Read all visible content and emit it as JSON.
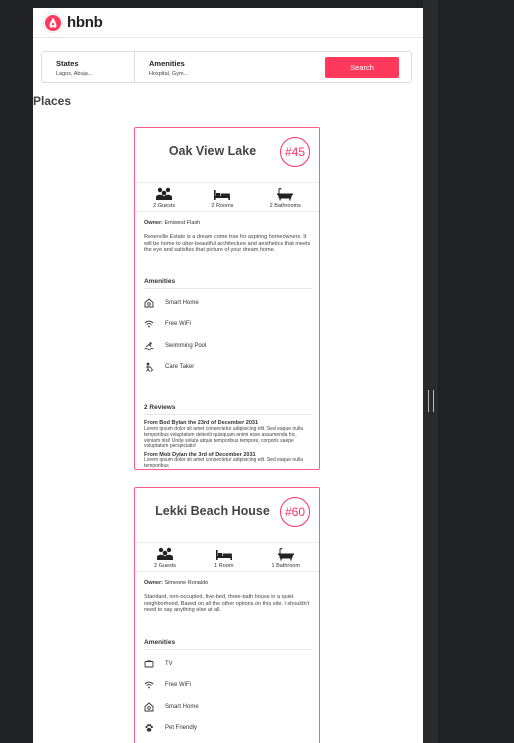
{
  "header": {
    "logo_text": "hbnb"
  },
  "filters": {
    "states": {
      "title": "States",
      "value": "Lagos, Abuja..."
    },
    "amenities": {
      "title": "Amenities",
      "value": "Hospital, Gym..."
    },
    "search_label": "Search"
  },
  "section_title": "Places",
  "places": [
    {
      "name": "Oak View Lake",
      "price": "#45",
      "guests": "2 Guests",
      "rooms": "2 Rooms",
      "bathrooms": "2 Bathrooms",
      "owner_label": "Owner:",
      "owner": "Emiwest Flash",
      "description": "Reserville Estate is a dream come true for aspiring homeowners. It will be home to uber-beautiful architecture and aesthetics that meets the eye and satisfies that picture of your dream home.",
      "amenities_title": "Amenities",
      "amenities": [
        {
          "label": "Smart Home",
          "icon": "smart-home-icon"
        },
        {
          "label": "Free WiFi",
          "icon": "wifi-icon"
        },
        {
          "label": "Swimming Pool",
          "icon": "pool-icon"
        },
        {
          "label": "Care Taker",
          "icon": "caretaker-icon"
        }
      ],
      "reviews_title": "2 Reviews",
      "reviews": [
        {
          "heading": "From Bod Bylan the 23rd of December 2031",
          "text": "Lorem ipsum dolor sit amet consectetur adipisicing elit. Sed eaque nulla temporibus voluptatum deleniti quisquam animi esse assumenda hic, veniam nisi! Unde soluta atque temporibus tempore, corporis saepe voluptatum perspiciatis!"
        },
        {
          "heading": "From Mob Dylan the 3rd of December 2031",
          "text": "Lorem ipsum dolor sit amet consectetur adipisicing elit. Sed eaque nulla temporibus"
        }
      ]
    },
    {
      "name": "Lekki Beach House",
      "price": "#60",
      "guests": "2 Guests",
      "rooms": "1 Room",
      "bathrooms": "1 Bathroom",
      "owner_label": "Owner:",
      "owner": "Simeone Ronaldo",
      "description": "Standard, non-occupied, five-bed, three-bath house in a quiet neighborhood. Based on all the other options on this site, I shouldn't need to say anything else at all.",
      "amenities_title": "Amenities",
      "amenities": [
        {
          "label": "TV",
          "icon": "tv-icon"
        },
        {
          "label": "Free WiFi",
          "icon": "wifi-icon"
        },
        {
          "label": "Smart Home",
          "icon": "smart-home-icon"
        },
        {
          "label": "Pet Friendly",
          "icon": "paw-icon"
        }
      ]
    }
  ],
  "colors": {
    "accent": "#ff385c",
    "card_border": "#ff5a8a",
    "badge": "#ff2f6a"
  }
}
